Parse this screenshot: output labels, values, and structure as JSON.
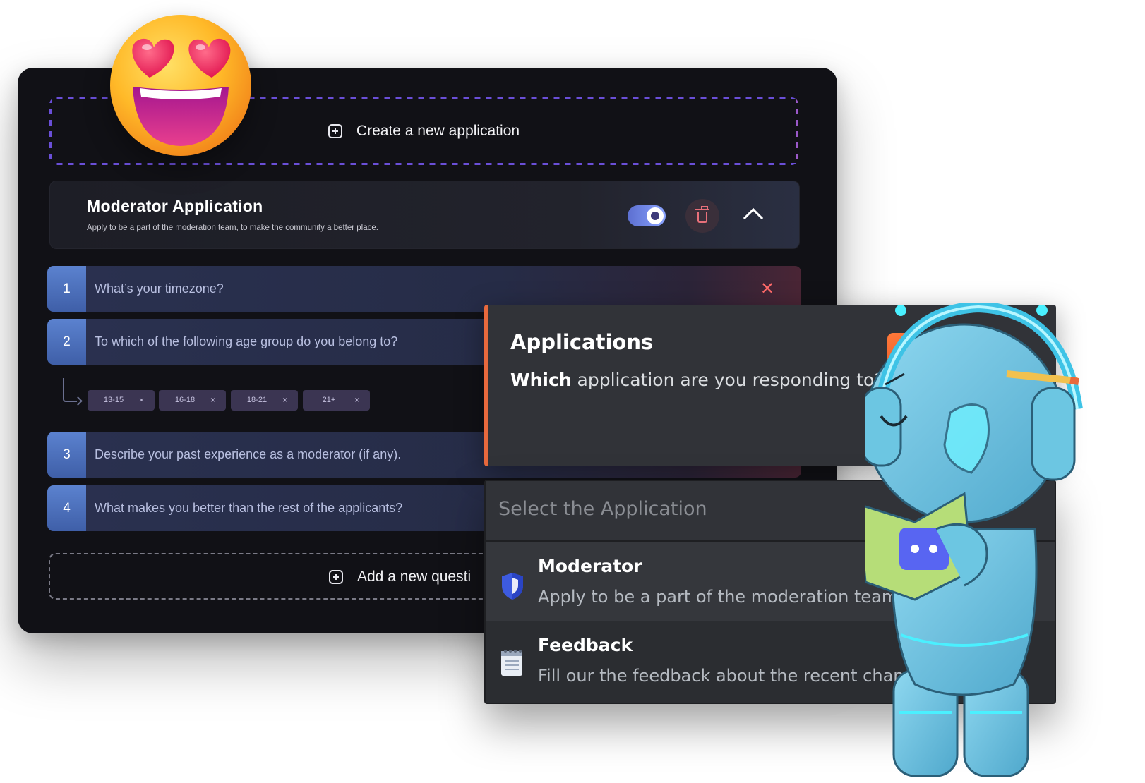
{
  "builder": {
    "create_label": "Create a new application",
    "application": {
      "title": "Moderator Application",
      "description": "Apply to be a part of the moderation team, to make the community a better place.",
      "enabled": true
    },
    "questions": [
      {
        "number": "1",
        "text": "What’s your timezone?"
      },
      {
        "number": "2",
        "text": "To which of the following age group do you belong to?"
      },
      {
        "number": "3",
        "text": "Describe your past experience as a moderator (if any)."
      },
      {
        "number": "4",
        "text": "What makes you better than the rest of the applicants?"
      }
    ],
    "age_options": [
      "13-15",
      "16-18",
      "18-21",
      "21+"
    ],
    "chip_remove": "×",
    "remove_glyph": "✕",
    "add_question_label": "Add a new questi"
  },
  "discord": {
    "title": "Applications",
    "question_bold": "Which",
    "question_rest": " application are you responding to?",
    "select_placeholder": "Select the Application",
    "options": [
      {
        "title": "Moderator",
        "description": "Apply to be a part of the moderation team.",
        "icon": "shield-icon"
      },
      {
        "title": "Feedback",
        "description": "Fill our the feedback about the recent change",
        "icon": "notepad-icon"
      }
    ]
  },
  "colors": {
    "accent_orange": "#e8693d",
    "toggle_on": "#6f86e6",
    "danger": "#ff6a6a",
    "question_number": "#4f73bf"
  }
}
